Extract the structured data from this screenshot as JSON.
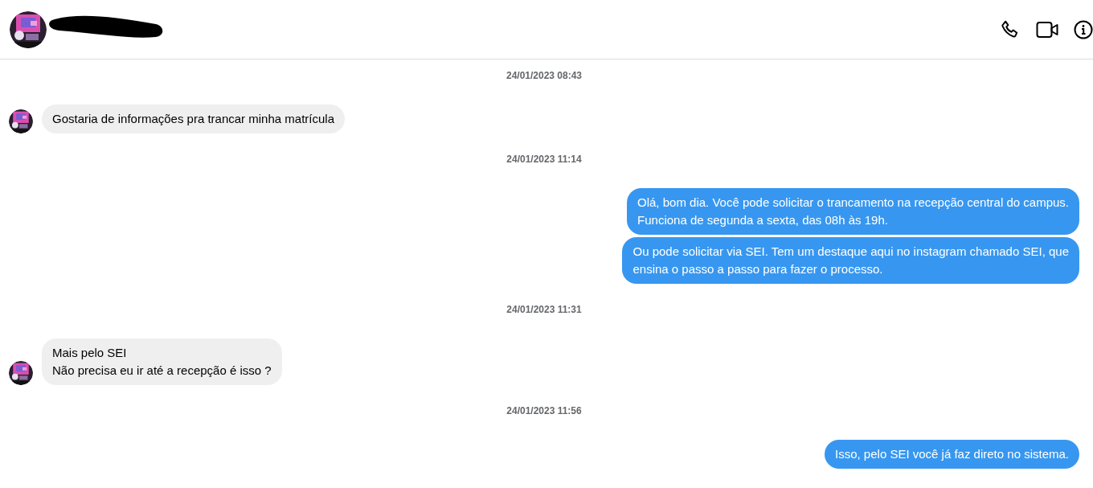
{
  "header": {
    "name_redacted": true,
    "actions": [
      {
        "kind": "phone"
      },
      {
        "kind": "video"
      },
      {
        "kind": "info"
      }
    ]
  },
  "messages": [
    {
      "kind": "timestamp",
      "text": "24/01/2023 08:43"
    },
    {
      "kind": "incoming",
      "text": "Gostaria de informações pra trancar minha matrícula"
    },
    {
      "kind": "timestamp",
      "text": "24/01/2023 11:14"
    },
    {
      "kind": "outgoing",
      "text": "Olá, bom dia. Você pode solicitar o trancamento na recepção central do campus.\nFunciona de segunda a sexta, das 08h às 19h."
    },
    {
      "kind": "outgoing",
      "text": "Ou pode solicitar via SEI. Tem um destaque aqui no instagram chamado SEI, que\nensina o passo a passo para fazer o processo."
    },
    {
      "kind": "timestamp",
      "text": "24/01/2023 11:31"
    },
    {
      "kind": "incoming",
      "text": "Mais pelo SEI\nNão precisa eu ir até a recepção é isso ?"
    },
    {
      "kind": "timestamp",
      "text": "24/01/2023 11:56"
    },
    {
      "kind": "outgoing",
      "text": "Isso, pelo SEI você já faz direto no sistema."
    }
  ]
}
